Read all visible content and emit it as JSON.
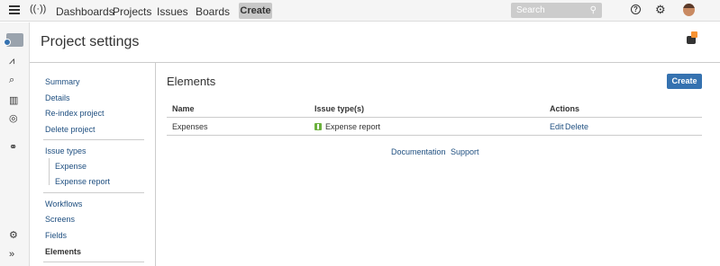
{
  "topbar": {
    "nav": [
      "Dashboards",
      "Projects",
      "Issues",
      "Boards"
    ],
    "create_label": "Create",
    "search_placeholder": "Search"
  },
  "page": {
    "title": "Project settings"
  },
  "sidebar": {
    "items": [
      {
        "label": "Summary"
      },
      {
        "label": "Details"
      },
      {
        "label": "Re-index project"
      },
      {
        "label": "Delete project"
      },
      {
        "label": "Issue types"
      },
      {
        "label": "Expense"
      },
      {
        "label": "Expense report"
      },
      {
        "label": "Workflows"
      },
      {
        "label": "Screens"
      },
      {
        "label": "Fields"
      },
      {
        "label": "Elements"
      }
    ]
  },
  "main": {
    "title": "Elements",
    "create_label": "Create",
    "table": {
      "columns": [
        "Name",
        "Issue type(s)",
        "Actions"
      ],
      "rows": [
        {
          "name": "Expenses",
          "issue_type": "Expense report",
          "edit": "Edit",
          "delete": "Delete"
        }
      ]
    },
    "links": [
      "Documentation",
      "Support"
    ]
  }
}
